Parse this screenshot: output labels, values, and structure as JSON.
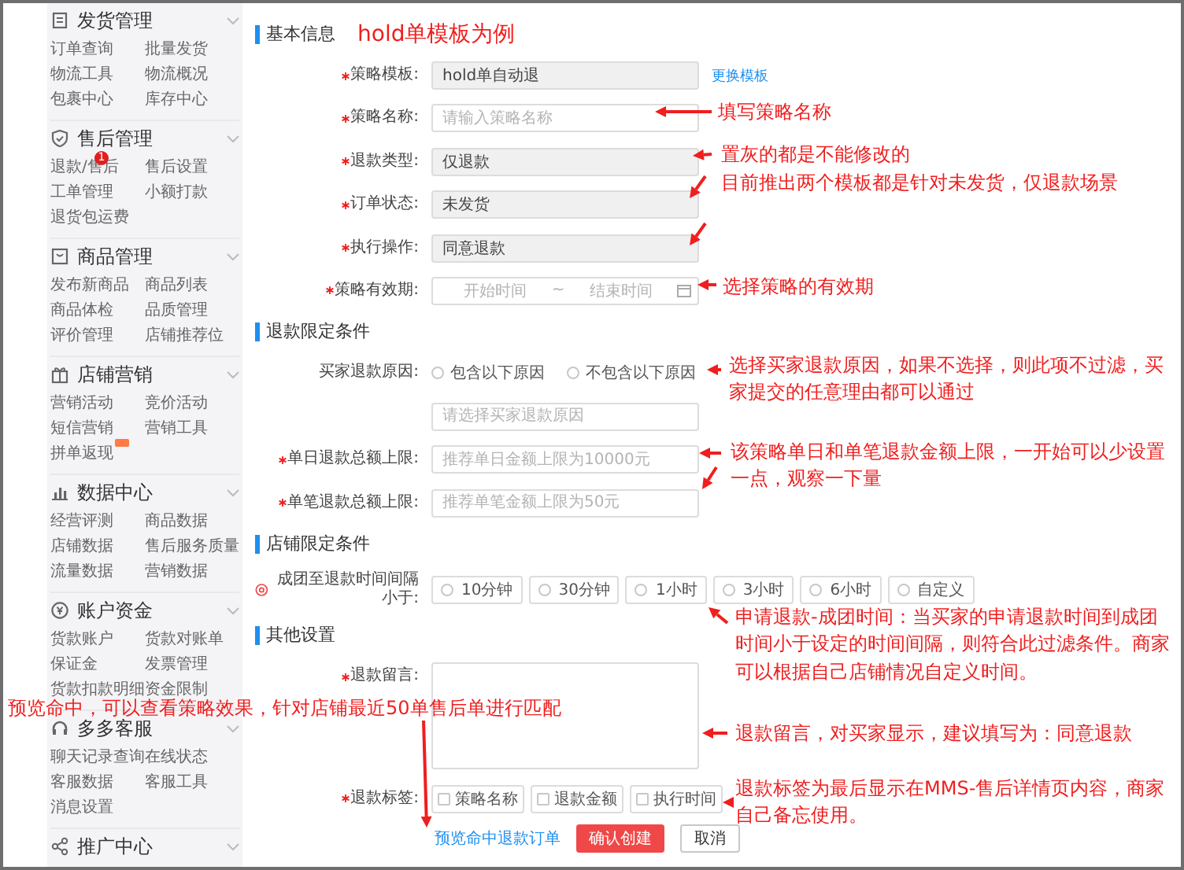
{
  "sidebar": {
    "sections": [
      {
        "title": "发货管理",
        "items": [
          {
            "label": "订单查询"
          },
          {
            "label": "批量发货"
          },
          {
            "label": "物流工具"
          },
          {
            "label": "物流概况"
          },
          {
            "label": "包裹中心"
          },
          {
            "label": "库存中心"
          }
        ]
      },
      {
        "title": "售后管理",
        "items": [
          {
            "label": "退款/售后",
            "badge": "1"
          },
          {
            "label": "售后设置"
          },
          {
            "label": "工单管理"
          },
          {
            "label": "小额打款"
          },
          {
            "label": "退货包运费"
          }
        ]
      },
      {
        "title": "商品管理",
        "items": [
          {
            "label": "发布新商品"
          },
          {
            "label": "商品列表"
          },
          {
            "label": "商品体检"
          },
          {
            "label": "品质管理"
          },
          {
            "label": "评价管理"
          },
          {
            "label": "店铺推荐位"
          }
        ]
      },
      {
        "title": "店铺营销",
        "items": [
          {
            "label": "营销活动"
          },
          {
            "label": "竞价活动"
          },
          {
            "label": "短信营销"
          },
          {
            "label": "营销工具"
          },
          {
            "label": "拼单返现",
            "hot": true
          }
        ]
      },
      {
        "title": "数据中心",
        "items": [
          {
            "label": "经营评测"
          },
          {
            "label": "商品数据"
          },
          {
            "label": "店铺数据"
          },
          {
            "label": "售后服务质量"
          },
          {
            "label": "流量数据"
          },
          {
            "label": "营销数据"
          }
        ]
      },
      {
        "title": "账户资金",
        "items": [
          {
            "label": "货款账户"
          },
          {
            "label": "货款对账单"
          },
          {
            "label": "保证金"
          },
          {
            "label": "发票管理"
          },
          {
            "label": "货款扣款明细"
          },
          {
            "label": "资金限制"
          }
        ]
      },
      {
        "title": "多多客服",
        "items": [
          {
            "label": "聊天记录查询"
          },
          {
            "label": "在线状态"
          },
          {
            "label": "客服数据"
          },
          {
            "label": "客服工具"
          },
          {
            "label": "消息设置"
          }
        ]
      },
      {
        "title": "推广中心"
      }
    ]
  },
  "form": {
    "sections": [
      {
        "title": "基本信息",
        "note": "hold单模板为例",
        "rows": [
          {
            "kind": "input",
            "label": "策略模板:",
            "required": true,
            "value": "hold单自动退",
            "disabled": true,
            "link": "更换模板"
          },
          {
            "kind": "input",
            "label": "策略名称:",
            "required": true,
            "placeholder": "请输入策略名称",
            "disabled": false
          },
          {
            "kind": "input",
            "label": "退款类型:",
            "required": true,
            "value": "仅退款",
            "disabled": true
          },
          {
            "kind": "input",
            "label": "订单状态:",
            "required": true,
            "value": "未发货",
            "disabled": true
          },
          {
            "kind": "input",
            "label": "执行操作:",
            "required": true,
            "value": "同意退款",
            "disabled": true
          },
          {
            "kind": "date_range",
            "label": "策略有效期:",
            "required": true,
            "start_placeholder": "开始时间",
            "separator": "~",
            "end_placeholder": "结束时间"
          }
        ]
      },
      {
        "title": "退款限定条件",
        "rows": [
          {
            "kind": "radios",
            "label": "买家退款原因:",
            "options": [
              {
                "label": "包含以下原因",
                "selected": false
              },
              {
                "label": "不包含以下原因",
                "selected": false
              }
            ]
          },
          {
            "kind": "input",
            "placeholder": "请选择买家退款原因",
            "disabled": false
          },
          {
            "kind": "input",
            "label": "单日退款总额上限:",
            "required": true,
            "placeholder": "推荐单日金额上限为10000元",
            "disabled": false
          },
          {
            "kind": "input",
            "label": "单笔退款总额上限:",
            "required": true,
            "placeholder": "推荐单笔金额上限为50元",
            "disabled": false
          }
        ]
      },
      {
        "title": "店铺限定条件",
        "rows": [
          {
            "kind": "radio_buttons",
            "label": "成团至退款时间间隔小于:",
            "hint": true,
            "options": [
              {
                "label": "10分钟",
                "selected": false
              },
              {
                "label": "30分钟",
                "selected": false
              },
              {
                "label": "1小时",
                "selected": false
              },
              {
                "label": "3小时",
                "selected": false
              },
              {
                "label": "6小时",
                "selected": false
              },
              {
                "label": "自定义",
                "selected": false
              }
            ]
          }
        ]
      },
      {
        "title": "其他设置",
        "rows": [
          {
            "kind": "textarea",
            "label": "退款留言:",
            "required": true
          },
          {
            "kind": "checkboxes",
            "label": "退款标签:",
            "required": true,
            "options": [
              {
                "label": "策略名称",
                "checked": false
              },
              {
                "label": "退款金额",
                "checked": false
              },
              {
                "label": "执行时间",
                "checked": false
              }
            ]
          }
        ]
      }
    ],
    "actions": {
      "preview_link": "预览命中退款订单",
      "confirm": "确认创建",
      "cancel": "取消"
    }
  },
  "annotations": [
    {
      "text": "填写策略名称"
    },
    {
      "text": "置灰的都是不能修改的"
    },
    {
      "text": "目前推出两个模板都是针对未发货，仅退款场景"
    },
    {
      "text": "选择策略的有效期"
    },
    {
      "text": "选择买家退款原因，如果不选择，则此项不过滤，买家提交的任意理由都可以通过"
    },
    {
      "text": "该策略单日和单笔退款金额上限，一开始可以少设置一点，观察一下量"
    },
    {
      "text": "申请退款-成团时间：当买家的申请退款时间到成团时间小于设定的时间间隔，则符合此过滤条件。商家可以根据自己店铺情况自定义时间。"
    },
    {
      "text": "退款留言，对买家显示，建议填写为：同意退款"
    },
    {
      "text": "退款标签为最后显示在MMS-售后详情页内容，商家自己备忘使用。"
    },
    {
      "text": "预览命中，可以查看策略效果，针对店铺最近50单售后单进行匹配"
    }
  ]
}
